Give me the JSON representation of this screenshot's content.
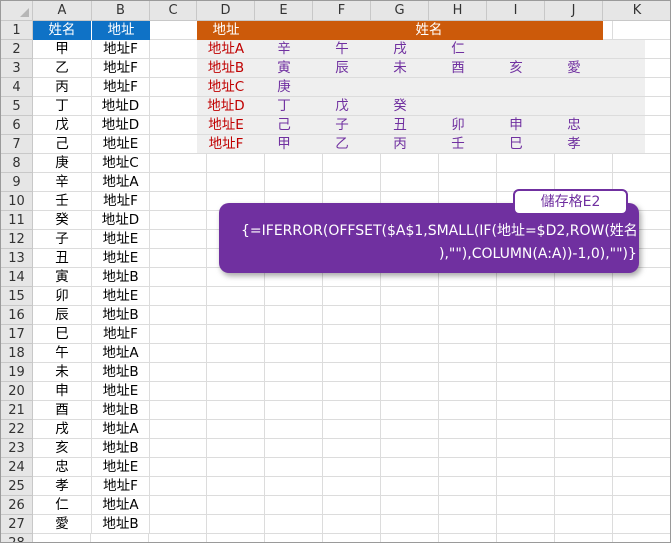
{
  "columns": [
    "A",
    "B",
    "C",
    "D",
    "E",
    "F",
    "G",
    "H",
    "I",
    "J",
    "K"
  ],
  "rows": [
    "1",
    "2",
    "3",
    "4",
    "5",
    "6",
    "7",
    "8",
    "9",
    "10",
    "11",
    "12",
    "13",
    "14",
    "15",
    "16",
    "17",
    "18",
    "19",
    "20",
    "21",
    "22",
    "23",
    "24",
    "25",
    "26",
    "27",
    "28"
  ],
  "source_table": {
    "header": {
      "name": "姓名",
      "address": "地址"
    },
    "rows": [
      {
        "name": "甲",
        "address": "地址F"
      },
      {
        "name": "乙",
        "address": "地址F"
      },
      {
        "name": "丙",
        "address": "地址F"
      },
      {
        "name": "丁",
        "address": "地址D"
      },
      {
        "name": "戊",
        "address": "地址D"
      },
      {
        "name": "己",
        "address": "地址E"
      },
      {
        "name": "庚",
        "address": "地址C"
      },
      {
        "name": "辛",
        "address": "地址A"
      },
      {
        "name": "壬",
        "address": "地址F"
      },
      {
        "name": "癸",
        "address": "地址D"
      },
      {
        "name": "子",
        "address": "地址E"
      },
      {
        "name": "丑",
        "address": "地址E"
      },
      {
        "name": "寅",
        "address": "地址B"
      },
      {
        "name": "卯",
        "address": "地址E"
      },
      {
        "name": "辰",
        "address": "地址B"
      },
      {
        "name": "巳",
        "address": "地址F"
      },
      {
        "name": "午",
        "address": "地址A"
      },
      {
        "name": "未",
        "address": "地址B"
      },
      {
        "name": "申",
        "address": "地址E"
      },
      {
        "name": "酉",
        "address": "地址B"
      },
      {
        "name": "戌",
        "address": "地址A"
      },
      {
        "name": "亥",
        "address": "地址B"
      },
      {
        "name": "忠",
        "address": "地址E"
      },
      {
        "name": "孝",
        "address": "地址F"
      },
      {
        "name": "仁",
        "address": "地址A"
      },
      {
        "name": "愛",
        "address": "地址B"
      }
    ]
  },
  "result_table": {
    "header": {
      "address": "地址",
      "names": "姓名"
    },
    "rows": [
      {
        "address": "地址A",
        "names": [
          "辛",
          "午",
          "戌",
          "仁",
          "",
          ""
        ]
      },
      {
        "address": "地址B",
        "names": [
          "寅",
          "辰",
          "未",
          "酉",
          "亥",
          "愛"
        ]
      },
      {
        "address": "地址C",
        "names": [
          "庚",
          "",
          "",
          "",
          "",
          ""
        ]
      },
      {
        "address": "地址D",
        "names": [
          "丁",
          "戊",
          "癸",
          "",
          "",
          ""
        ]
      },
      {
        "address": "地址E",
        "names": [
          "己",
          "子",
          "丑",
          "卯",
          "申",
          "忠"
        ]
      },
      {
        "address": "地址F",
        "names": [
          "甲",
          "乙",
          "丙",
          "壬",
          "巳",
          "孝"
        ]
      }
    ]
  },
  "callout": {
    "tag": "儲存格E2",
    "formula_line1": "{=IFERROR(OFFSET($A$1,SMALL(IF(地址=$D2,ROW(姓名",
    "formula_line2": "),\"\"),COLUMN(A:A))-1,0),\"\")}"
  },
  "colors": {
    "header_blue": "#0f72c6",
    "header_orange": "#cc5a0a",
    "address_red": "#c00000",
    "name_purple": "#7030a0",
    "callout_purple": "#7030a0"
  }
}
